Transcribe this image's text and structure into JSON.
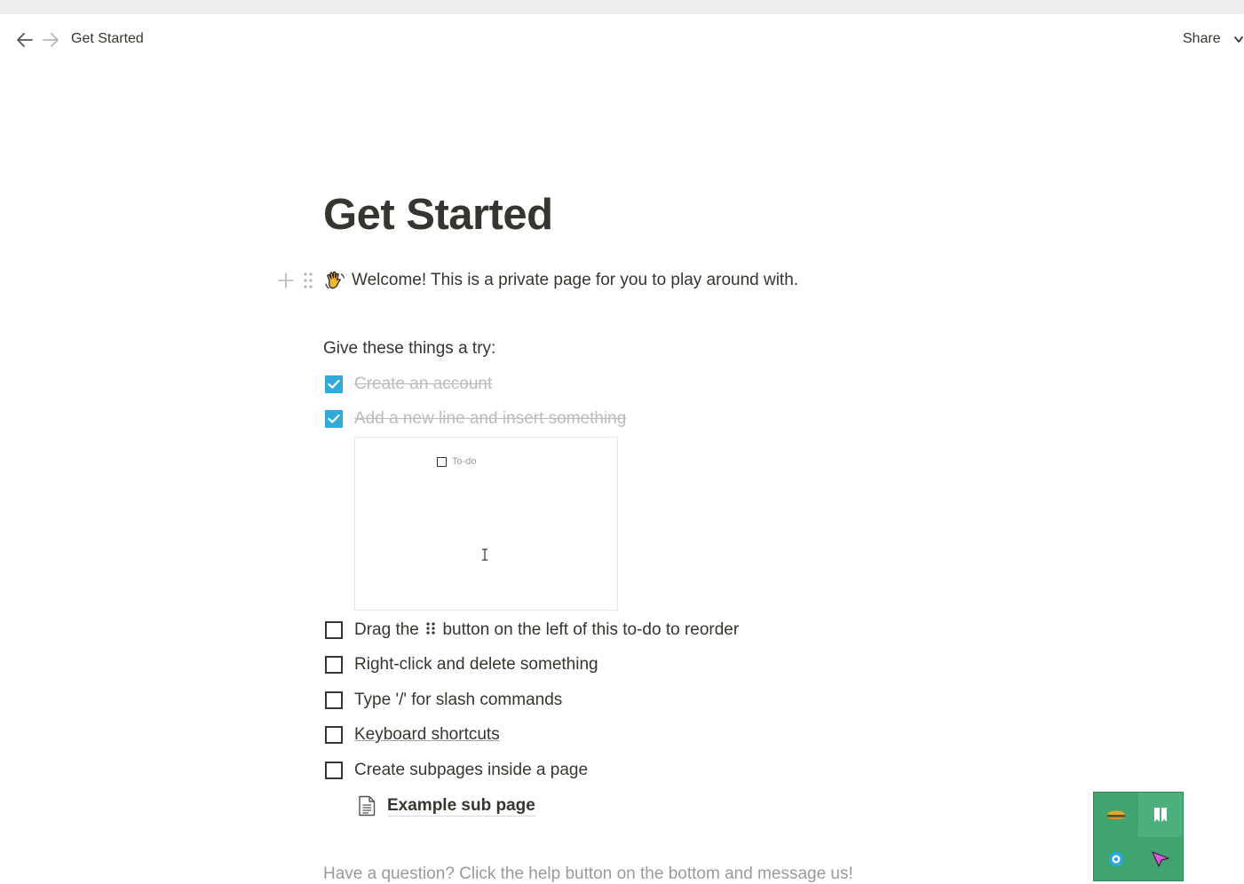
{
  "topbar": {
    "breadcrumb": "Get Started",
    "share_label": "Share",
    "back_icon": "arrow-left-icon",
    "forward_icon": "arrow-right-icon"
  },
  "page": {
    "title": "Get Started",
    "welcome": "Welcome! This is a private page for you to play around with.",
    "welcome_icon": "waving-hand-icon",
    "try_label": "Give these things a try:",
    "todos": [
      {
        "text": "Create an account",
        "checked": true
      },
      {
        "text": "Add a new line and insert something",
        "checked": true
      },
      {
        "text_before": "Drag the",
        "text_after": "button on the left of this to-do to reorder",
        "checked": false
      },
      {
        "text": "Right-click and delete something",
        "checked": false
      },
      {
        "text": "Type '/' for slash commands",
        "checked": false
      },
      {
        "text": "Keyboard shortcuts",
        "checked": false,
        "link": true
      },
      {
        "text": "Create subpages inside a page",
        "checked": false
      }
    ],
    "demo": {
      "label": "To-do"
    },
    "subpage": {
      "label": "Example sub page",
      "icon": "page-icon"
    },
    "help": "Have a question? Click the help button on the bottom and message us!"
  },
  "extension_panel": {
    "buttons": [
      "burger-icon",
      "bookmark-icon",
      "target-icon",
      "cursor-arrow-icon"
    ]
  },
  "colors": {
    "text": "#37352f",
    "checkbox_checked": "#2eaadc",
    "muted": "#9b9a97",
    "extension_green": "#3fa46e"
  }
}
